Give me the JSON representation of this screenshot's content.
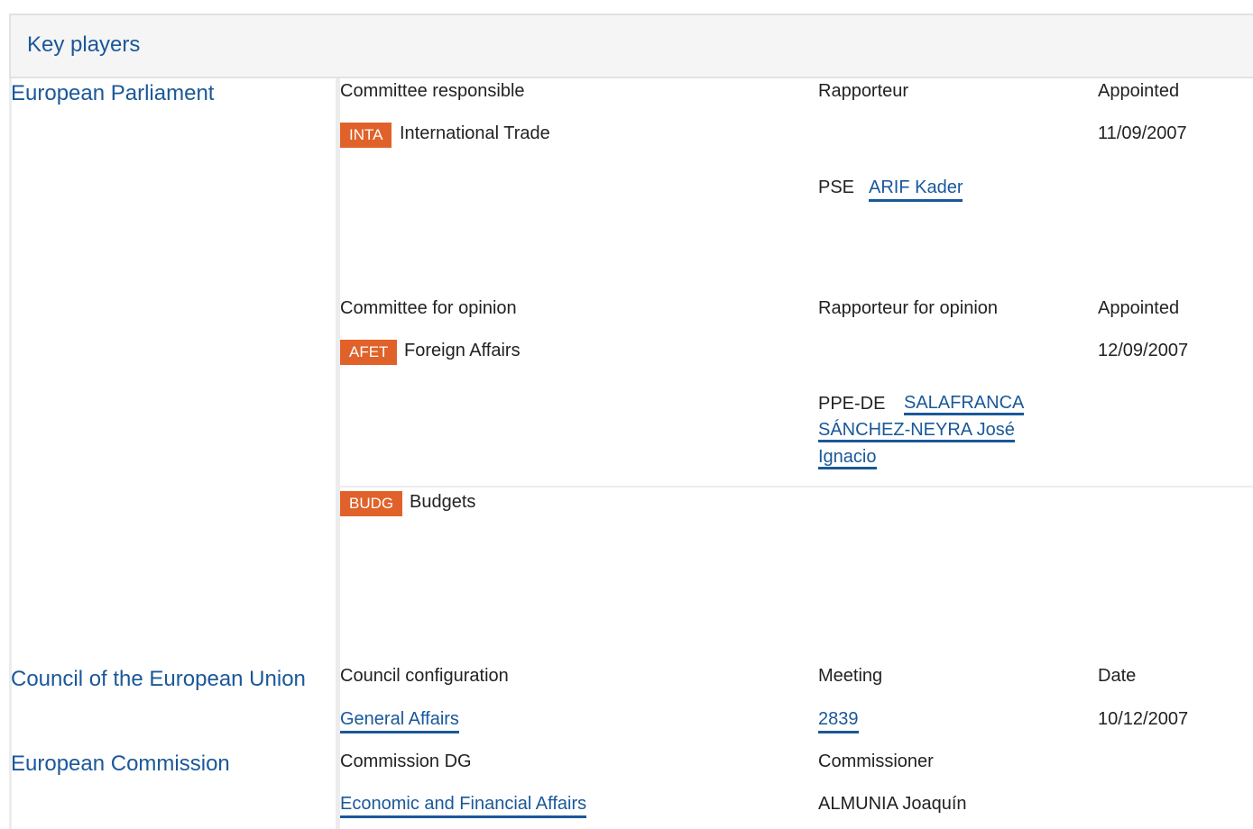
{
  "header": {
    "title": "Key players"
  },
  "ep": {
    "title": "European Parliament",
    "responsible": {
      "col_committee": "Committee responsible",
      "col_rapporteur": "Rapporteur",
      "col_appointed": "Appointed",
      "badge": "INTA",
      "committee": "International Trade",
      "date": "11/09/2007",
      "group": "PSE",
      "rapporteur": "ARIF Kader"
    },
    "opinion": {
      "col_committee": "Committee for opinion",
      "col_rapporteur": "Rapporteur for opinion",
      "col_appointed": "Appointed",
      "afet_badge": "AFET",
      "afet_committee": "Foreign Affairs",
      "afet_date": "12/09/2007",
      "afet_group": "PPE-DE",
      "afet_rapporteur_line1": "SALAFRANCA",
      "afet_rapporteur_line2": "SÁNCHEZ-NEYRA José",
      "afet_rapporteur_line3": "Ignacio",
      "budg_badge": "BUDG",
      "budg_committee": "Budgets"
    }
  },
  "council": {
    "title": "Council of the European Union",
    "col_config": "Council configuration",
    "col_meeting": "Meeting",
    "col_date": "Date",
    "config": "General Affairs",
    "meeting": "2839",
    "date": "10/12/2007"
  },
  "commission": {
    "title": "European Commission",
    "col_dg": "Commission DG",
    "col_commissioner": "Commissioner",
    "dg": "Economic and Financial Affairs",
    "commissioner": "ALMUNIA Joaquín"
  },
  "colors": {
    "link": "#1a5899",
    "badge": "#e0622a",
    "header_bg": "#f5f5f5"
  }
}
